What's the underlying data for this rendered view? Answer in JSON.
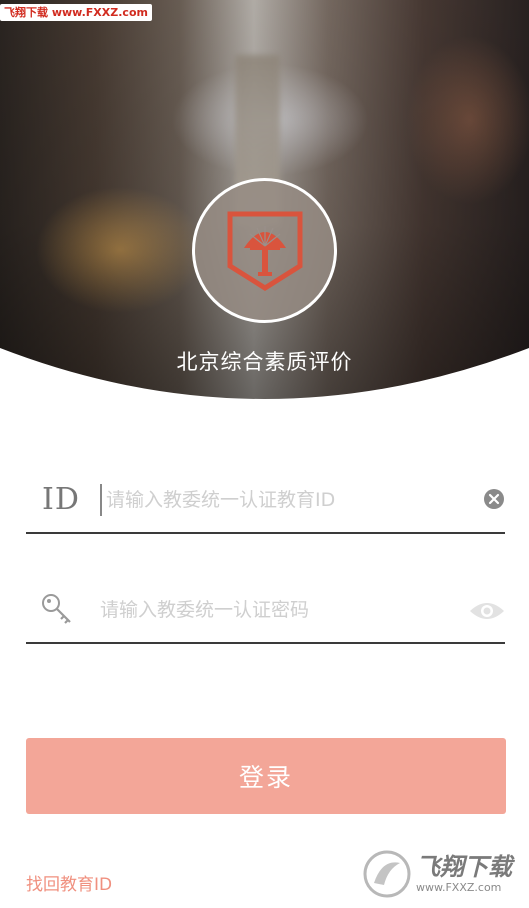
{
  "header": {
    "watermark": "飞翔下载 www.FXXZ.com",
    "app_title": "北京综合素质评价"
  },
  "form": {
    "id_label": "ID",
    "id_placeholder": "请输入教委统一认证教育ID",
    "password_placeholder": "请输入教委统一认证密码"
  },
  "actions": {
    "login_label": "登录",
    "recover_label": "找回教育ID"
  },
  "badge": {
    "main": "飞翔下载",
    "url": "www.FXXZ.com"
  },
  "colors": {
    "accent": "#f3a698",
    "link": "#f0907f",
    "logo_red": "#d9543d"
  }
}
